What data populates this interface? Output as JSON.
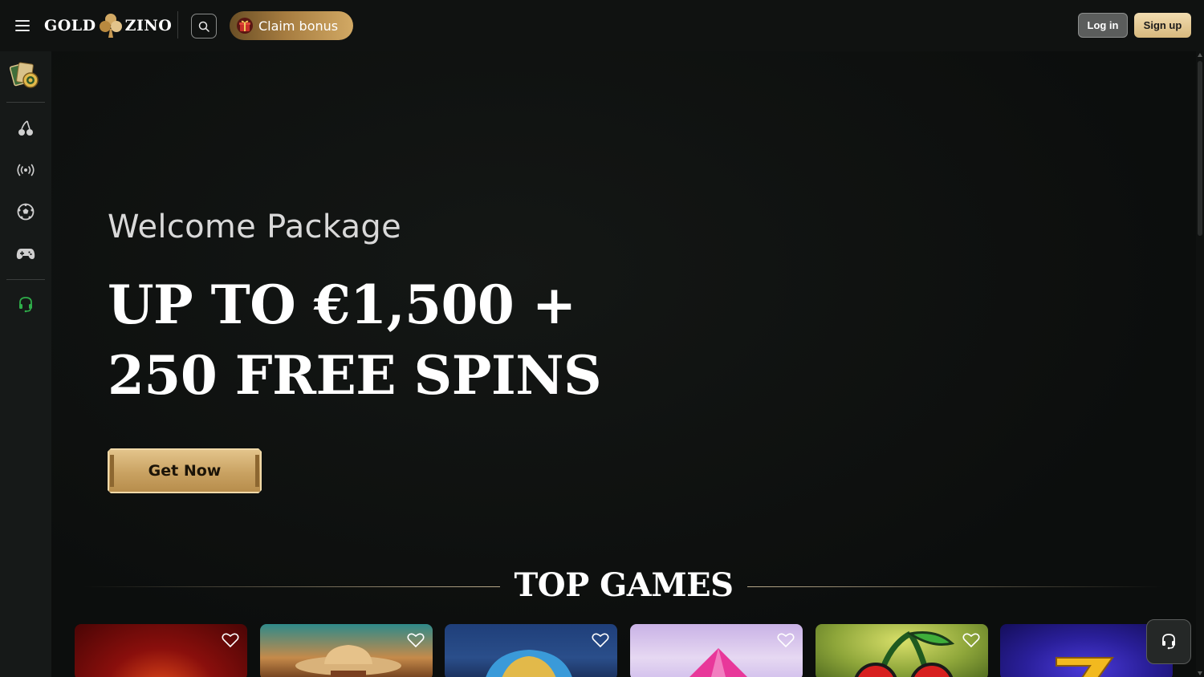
{
  "header": {
    "logo_left": "GOLD",
    "logo_right": "ZINO",
    "claim_bonus_label": "Claim bonus",
    "login_label": "Log in",
    "signup_label": "Sign up"
  },
  "sidebar": {
    "items": [
      {
        "icon": "casino-chips-icon"
      },
      {
        "icon": "cherry-slots-icon"
      },
      {
        "icon": "live-broadcast-icon"
      },
      {
        "icon": "football-icon"
      },
      {
        "icon": "gamepad-icon"
      },
      {
        "icon": "headset-support-icon",
        "color": "#2fae4a"
      }
    ]
  },
  "hero": {
    "welcome": "Welcome Package",
    "line1": "UP TO €1,500 +",
    "line2": "250 FREE SPINS",
    "cta_label": "Get Now"
  },
  "top_games": {
    "title": "TOP GAMES",
    "cards": [
      {
        "icon": "heart-icon",
        "theme": "red-fire"
      },
      {
        "icon": "heart-icon",
        "theme": "cowboy-desert"
      },
      {
        "icon": "heart-icon",
        "theme": "egyptian-blue"
      },
      {
        "icon": "heart-icon",
        "theme": "pink-gem"
      },
      {
        "icon": "heart-icon",
        "theme": "cherry-green"
      },
      {
        "icon": "heart-icon",
        "theme": "gold-seven"
      }
    ]
  },
  "colors": {
    "accent_gold": "#d2a964",
    "background": "#0d0f0e",
    "sidebar": "#161918",
    "support_green": "#2fae4a"
  }
}
